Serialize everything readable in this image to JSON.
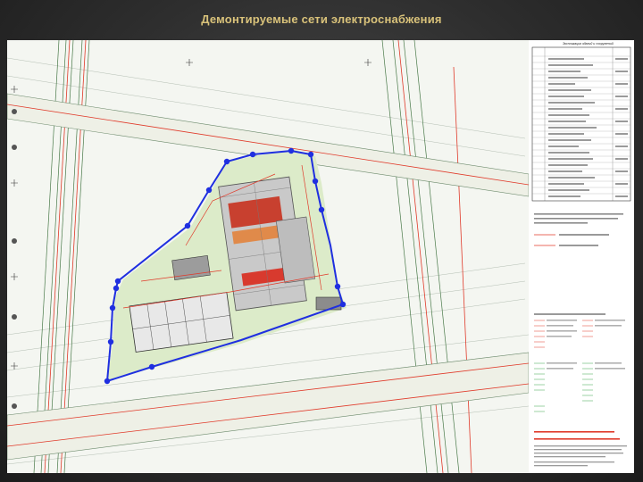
{
  "slide": {
    "title": "Демонтируемые сети электроснабжения"
  },
  "colors": {
    "background": "#2e2e2e",
    "title": "#d9c27a",
    "boundary": "#1f2fe0",
    "demolished": "#e03a2a",
    "grid_green": "#3aa64a",
    "site_fill": "#cfe6b9"
  },
  "legend": {
    "heading": "Экспликация зданий и сооружений"
  }
}
